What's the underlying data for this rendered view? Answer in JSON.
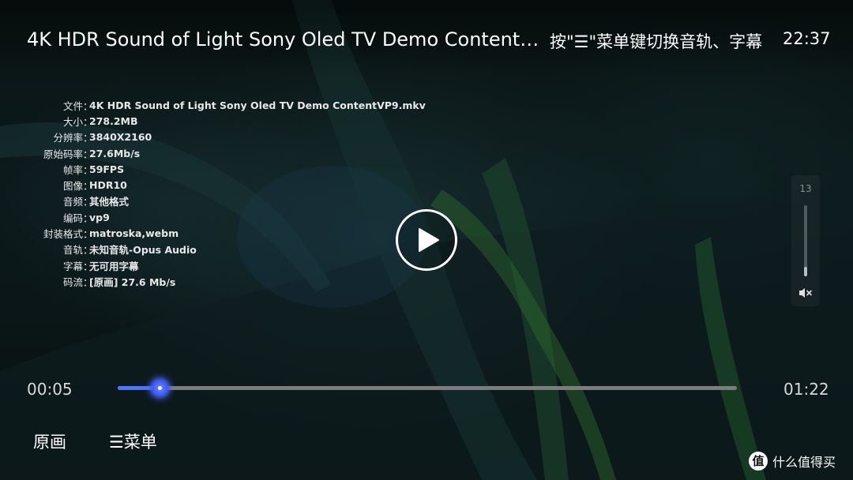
{
  "header": {
    "title": "4K HDR Sound of Light Sony Oled TV Demo Content…",
    "menu_hint": "按\"☰\"菜单键切换音轨、字幕",
    "clock": "22:37"
  },
  "media_info": [
    {
      "label": "文件",
      "value": "4K HDR Sound of Light Sony Oled TV Demo ContentVP9.mkv"
    },
    {
      "label": "大小",
      "value": "278.2MB"
    },
    {
      "label": "分辨率",
      "value": "3840X2160"
    },
    {
      "label": "原始码率",
      "value": "27.6Mb/s"
    },
    {
      "label": "帧率",
      "value": "59FPS"
    },
    {
      "label": "图像",
      "value": "HDR10"
    },
    {
      "label": "音频",
      "value": "其他格式"
    },
    {
      "label": "编码",
      "value": "vp9"
    },
    {
      "label": "封装格式",
      "value": "matroska,webm"
    },
    {
      "label": "音轨",
      "value": "未知音轨-Opus Audio"
    },
    {
      "label": "字幕",
      "value": "无可用字幕"
    },
    {
      "label": "码流",
      "value": "[原画] 27.6 Mb/s"
    }
  ],
  "info_separator": "：",
  "player": {
    "play_icon": "play-icon",
    "current_time": "00:05",
    "total_time": "01:22",
    "progress_fraction": 0.068,
    "accent_color": "#4f72ff"
  },
  "volume": {
    "value": "13",
    "level_fraction": 0.13,
    "mute_icon": "volume-mute-icon"
  },
  "bottom_bar": {
    "original_label": "原画",
    "menu_label": "☰菜单"
  },
  "watermark": {
    "logo_text": "值",
    "text": "什么值得买"
  }
}
